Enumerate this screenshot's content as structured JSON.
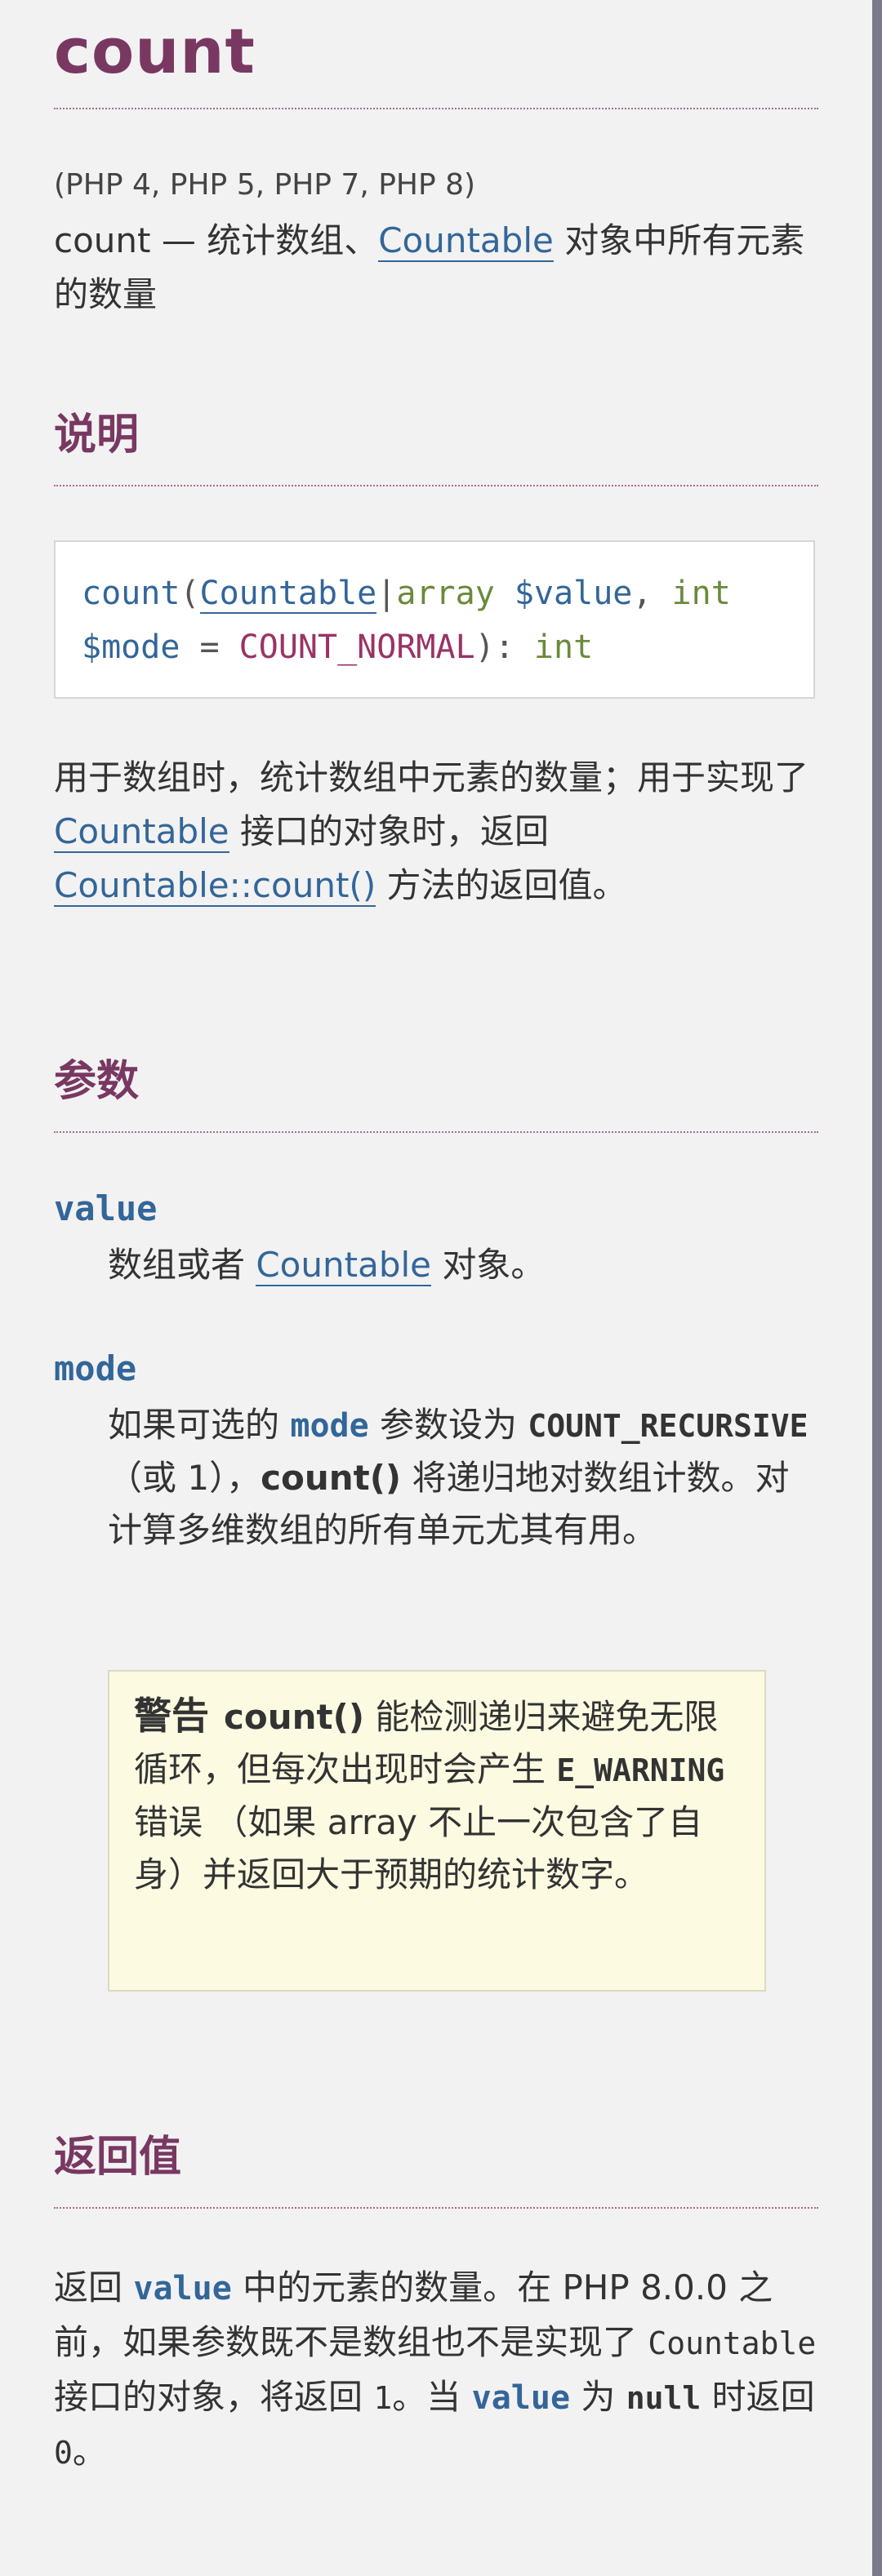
{
  "page": {
    "title": "count",
    "versions": "(PHP 4, PHP 5, PHP 7, PHP 8)",
    "refname": "count — 统计数组、",
    "refname_link": "Countable",
    "refname_rest": " 对象中所有元素的数量"
  },
  "description": {
    "heading": "说明",
    "code": {
      "fn": "count",
      "open": "(",
      "type1": "Countable",
      "pipe": "|",
      "type2": "array",
      "param1": " $value",
      "comma": ", ",
      "int1": "int",
      "param2": "$mode",
      "eq": " = ",
      "default": "COUNT_NORMAL",
      "close": "): ",
      "ret": "int"
    },
    "text1": "用于数组时，统计数组中元素的数量；用于实现了 ",
    "link1": "Countable",
    "text2": " 接口的对象时，返回 ",
    "link2": "Countable::count()",
    "text3": " 方法的返回值。"
  },
  "parameters": {
    "heading": "参数",
    "value_term": "value",
    "value_def_a": "数组或者 ",
    "value_def_link": "Countable",
    "value_def_b": " 对象。",
    "mode_term": "mode",
    "mode_def_a": "如果可选的 ",
    "mode_def_kw": "mode",
    "mode_def_b": " 参数设为 ",
    "mode_def_const": "COUNT_RECURSIVE",
    "mode_def_c": "（或 1），",
    "mode_def_fn": "count()",
    "mode_def_d": " 将递归地对数组计数。对计算多维数组的所有单元尤其有用。",
    "warning": {
      "title": "警告",
      "fn": "count()",
      "text_a": " 能检测递归来避免无限循环，但每次出现时会产生 ",
      "const": "E_WARNING",
      "text_b": " 错误 （如果 array 不止一次包含了自身）并返回大于预期的统计数字。"
    }
  },
  "returns": {
    "heading": "返回值",
    "a": "返回 ",
    "kw1": "value",
    "b": " 中的元素的数量。在 PHP 8.0.0 之前，如果参数既不是数组也不是实现了 ",
    "mono1": "Countable",
    "c": " 接口的对象，将返回 ",
    "mono2": "1",
    "d": "。当 ",
    "kw2": "value",
    "e": " 为 ",
    "null": "null",
    "f": " 时返回 ",
    "mono3": "0",
    "g": "。"
  }
}
